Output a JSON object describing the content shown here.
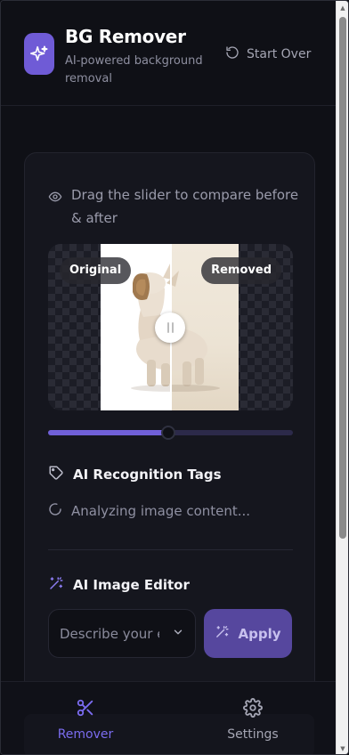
{
  "header": {
    "title": "BG Remover",
    "subtitle": "AI-powered background removal",
    "start_over_label": "Start Over"
  },
  "compare": {
    "hint": "Drag the slider to compare before & after",
    "label_original": "Original",
    "label_removed": "Removed",
    "slider_value_percent": 49
  },
  "tags_section": {
    "title": "AI Recognition Tags",
    "status": "Analyzing image content..."
  },
  "editor_section": {
    "title": "AI Image Editor",
    "prompt_placeholder": "Describe your e",
    "apply_label": "Apply"
  },
  "nav": {
    "items": [
      {
        "label": "Remover",
        "icon": "scissors-icon",
        "active": true
      },
      {
        "label": "Settings",
        "icon": "gear-icon",
        "active": false
      }
    ]
  },
  "colors": {
    "accent": "#7060d8",
    "background": "#0f1016",
    "card": "#15161e"
  }
}
